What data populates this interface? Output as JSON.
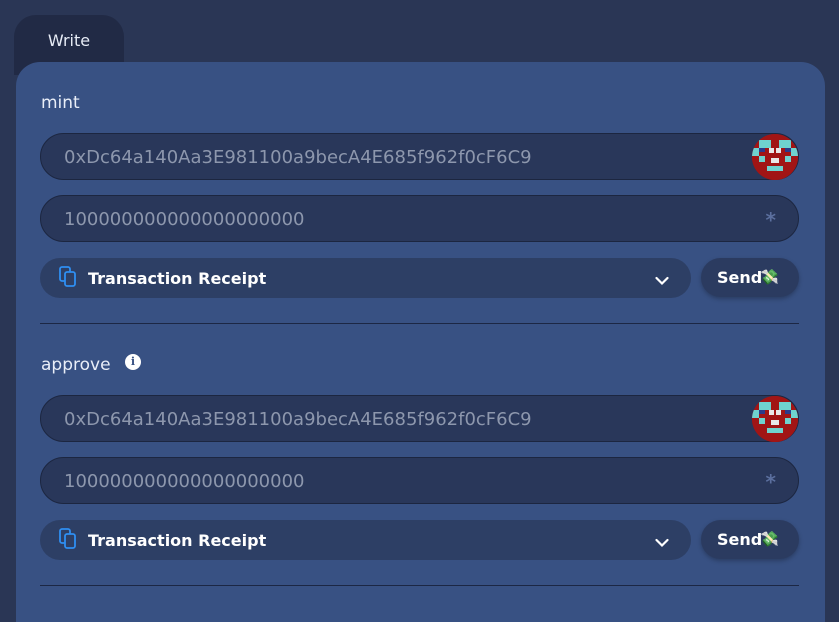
{
  "tab": {
    "label": "Write"
  },
  "functions": [
    {
      "name": "mint",
      "has_info": false,
      "address_value": "0xDc64a140Aa3E981100a9becA4E685f962f0cF6C9",
      "amount_value": "100000000000000000000",
      "receipt_label": "Transaction Receipt",
      "send_label": "Send",
      "send_emoji": "💸"
    },
    {
      "name": "approve",
      "has_info": true,
      "address_value": "0xDc64a140Aa3E981100a9becA4E685f962f0cF6C9",
      "amount_value": "100000000000000000000",
      "receipt_label": "Transaction Receipt",
      "send_label": "Send",
      "send_emoji": "💸"
    }
  ],
  "icons": {
    "info": "info-icon",
    "required": "asterisk-icon",
    "copy": "copy-icon",
    "chevron": "chevron-down-icon",
    "avatar": "blockie-avatar"
  },
  "colors": {
    "background": "#2a3655",
    "card": "#385183",
    "input": "#29375a",
    "tab": "#212a45",
    "avatar_red": "#a11515",
    "avatar_cyan": "#6fd3cf"
  }
}
